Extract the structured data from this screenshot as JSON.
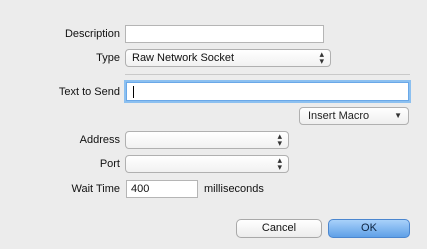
{
  "form": {
    "description": {
      "label": "Description",
      "value": ""
    },
    "type": {
      "label": "Type",
      "selected": "Raw Network Socket"
    },
    "text_to_send": {
      "label": "Text to Send",
      "value": ""
    },
    "insert_macro": {
      "label": "Insert Macro"
    },
    "address": {
      "label": "Address",
      "selected": ""
    },
    "port": {
      "label": "Port",
      "selected": ""
    },
    "wait_time": {
      "label": "Wait Time",
      "value": "400",
      "unit": "milliseconds"
    }
  },
  "buttons": {
    "cancel": "Cancel",
    "ok": "OK"
  },
  "icons": {
    "popup_arrows": "up-down-arrows-icon",
    "menu_arrow": "triangle-down-icon"
  },
  "colors": {
    "accent": "#5fa0e7",
    "focus_ring": "#8cc0f0",
    "sheet_bg": "#ececec"
  }
}
